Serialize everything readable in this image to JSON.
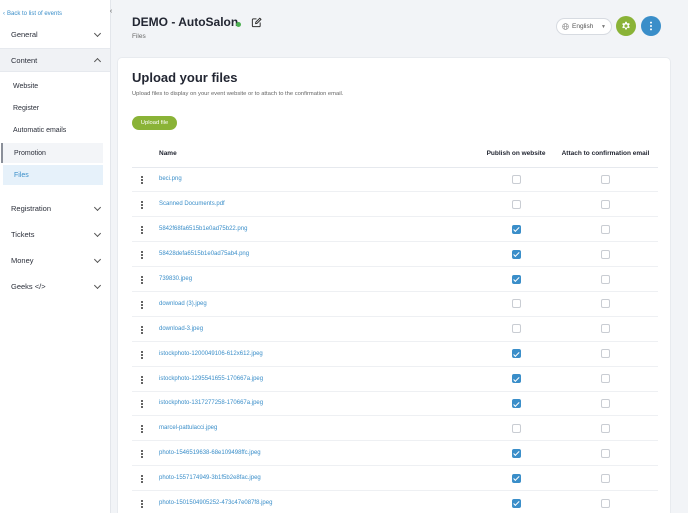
{
  "sidebar": {
    "back_link": "Back to list of events",
    "sections": [
      "General",
      "Content",
      "Registration",
      "Tickets",
      "Money",
      "Geeks </>"
    ],
    "content_items": [
      "Website",
      "Register",
      "Automatic emails",
      "Promotion",
      "Files"
    ]
  },
  "header": {
    "title": "DEMO - AutoSalon",
    "breadcrumb": "Files",
    "language": "English"
  },
  "main": {
    "title": "Upload your files",
    "subtitle": "Upload files to display on your event website or to attach to the confirmation email.",
    "upload_button": "Upload file",
    "columns": {
      "name": "Name",
      "publish": "Publish on website",
      "attach": "Attach to confirmation email"
    },
    "files": [
      {
        "name": "beci.png",
        "publish": false,
        "attach": false
      },
      {
        "name": "Scanned Documents.pdf",
        "publish": false,
        "attach": false
      },
      {
        "name": "5842f68fa6515b1e0ad75b22.png",
        "publish": true,
        "attach": false
      },
      {
        "name": "58428defa6515b1e0ad75ab4.png",
        "publish": true,
        "attach": false
      },
      {
        "name": "739830.jpeg",
        "publish": true,
        "attach": false
      },
      {
        "name": "download (3).jpeg",
        "publish": false,
        "attach": false
      },
      {
        "name": "download-3.jpeg",
        "publish": false,
        "attach": false
      },
      {
        "name": "istockphoto-1200049106-612x612.jpeg",
        "publish": true,
        "attach": false
      },
      {
        "name": "istockphoto-1295541655-170667a.jpeg",
        "publish": true,
        "attach": false
      },
      {
        "name": "istockphoto-1317277258-170667a.jpeg",
        "publish": true,
        "attach": false
      },
      {
        "name": "marcel-pattulacci.jpeg",
        "publish": false,
        "attach": false
      },
      {
        "name": "photo-1546519638-68e109498ffc.jpeg",
        "publish": true,
        "attach": false
      },
      {
        "name": "photo-1557174949-3b1f5b2e8fac.jpeg",
        "publish": true,
        "attach": false
      },
      {
        "name": "photo-1501504905252-473c47e087f8.jpeg",
        "publish": true,
        "attach": false
      }
    ]
  },
  "colors": {
    "accent": "#3a8ec9",
    "brand_green": "#8ab337",
    "live": "#4caf50"
  },
  "icons": [
    "chevron-left-icon",
    "chevron-down-icon",
    "chevron-up-icon",
    "edit-icon",
    "globe-icon",
    "gear-icon",
    "more-vertical-icon",
    "drag-handle-icon",
    "checkbox-icon"
  ]
}
